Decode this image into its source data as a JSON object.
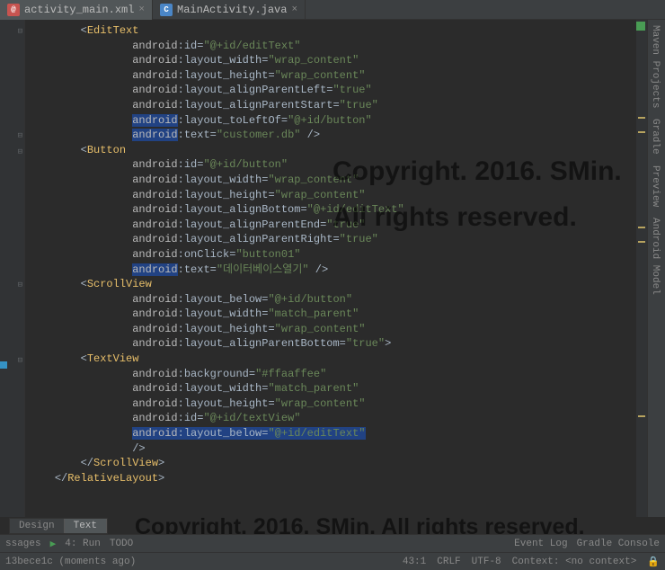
{
  "tabs": [
    {
      "icon": "xml",
      "iconText": "@",
      "label": "activity_main.xml",
      "close": "×"
    },
    {
      "icon": "java",
      "iconText": "C",
      "label": "MainActivity.java",
      "close": "×"
    }
  ],
  "editor": {
    "lines": [
      {
        "ind": 2,
        "parts": [
          {
            "c": "punc",
            "t": "<"
          },
          {
            "c": "tag",
            "t": "EditText"
          }
        ]
      },
      {
        "ind": 4,
        "parts": [
          {
            "c": "ns",
            "t": "android"
          },
          {
            "c": "attr",
            "t": ":id="
          },
          {
            "c": "str",
            "t": "\"@+id/editText\""
          }
        ]
      },
      {
        "ind": 4,
        "parts": [
          {
            "c": "ns",
            "t": "android"
          },
          {
            "c": "attr",
            "t": ":layout_width="
          },
          {
            "c": "str",
            "t": "\"wrap_content\""
          }
        ]
      },
      {
        "ind": 4,
        "parts": [
          {
            "c": "ns",
            "t": "android"
          },
          {
            "c": "attr",
            "t": ":layout_height="
          },
          {
            "c": "str",
            "t": "\"wrap_content\""
          }
        ]
      },
      {
        "ind": 4,
        "parts": [
          {
            "c": "ns",
            "t": "android"
          },
          {
            "c": "attr",
            "t": ":layout_alignParentLeft="
          },
          {
            "c": "str",
            "t": "\"true\""
          }
        ]
      },
      {
        "ind": 4,
        "parts": [
          {
            "c": "ns",
            "t": "android"
          },
          {
            "c": "attr",
            "t": ":layout_alignParentStart="
          },
          {
            "c": "str",
            "t": "\"true\""
          }
        ]
      },
      {
        "ind": 4,
        "parts": [
          {
            "c": "ns hl",
            "t": "android"
          },
          {
            "c": "attr",
            "t": ":layout_toLeftOf="
          },
          {
            "c": "str",
            "t": "\"@+id/button\""
          }
        ]
      },
      {
        "ind": 4,
        "parts": [
          {
            "c": "ns hl",
            "t": "android"
          },
          {
            "c": "attr",
            "t": ":text="
          },
          {
            "c": "str",
            "t": "\"customer.db\""
          },
          {
            "c": "punc",
            "t": " />"
          }
        ]
      },
      {
        "ind": 2,
        "parts": [
          {
            "c": "punc",
            "t": "<"
          },
          {
            "c": "tag",
            "t": "Button"
          }
        ]
      },
      {
        "ind": 4,
        "parts": [
          {
            "c": "ns",
            "t": "android"
          },
          {
            "c": "attr",
            "t": ":id="
          },
          {
            "c": "str",
            "t": "\"@+id/button\""
          }
        ]
      },
      {
        "ind": 4,
        "parts": [
          {
            "c": "ns",
            "t": "android"
          },
          {
            "c": "attr",
            "t": ":layout_width="
          },
          {
            "c": "str",
            "t": "\"wrap_content\""
          }
        ]
      },
      {
        "ind": 4,
        "parts": [
          {
            "c": "ns",
            "t": "android"
          },
          {
            "c": "attr",
            "t": ":layout_height="
          },
          {
            "c": "str",
            "t": "\"wrap_content\""
          }
        ]
      },
      {
        "ind": 4,
        "parts": [
          {
            "c": "ns",
            "t": "android"
          },
          {
            "c": "attr",
            "t": ":layout_alignBottom="
          },
          {
            "c": "str",
            "t": "\"@+id/editText\""
          }
        ]
      },
      {
        "ind": 4,
        "parts": [
          {
            "c": "ns",
            "t": "android"
          },
          {
            "c": "attr",
            "t": ":layout_alignParentEnd="
          },
          {
            "c": "str",
            "t": "\"true\""
          }
        ]
      },
      {
        "ind": 4,
        "parts": [
          {
            "c": "ns",
            "t": "android"
          },
          {
            "c": "attr",
            "t": ":layout_alignParentRight="
          },
          {
            "c": "str",
            "t": "\"true\""
          }
        ]
      },
      {
        "ind": 4,
        "parts": [
          {
            "c": "ns",
            "t": "android"
          },
          {
            "c": "attr",
            "t": ":onClick="
          },
          {
            "c": "str",
            "t": "\"button01\""
          }
        ]
      },
      {
        "ind": 4,
        "parts": [
          {
            "c": "ns hl",
            "t": "android"
          },
          {
            "c": "attr",
            "t": ":text="
          },
          {
            "c": "str",
            "t": "\"데이터베이스열기\""
          },
          {
            "c": "punc",
            "t": " />"
          }
        ]
      },
      {
        "ind": 2,
        "parts": [
          {
            "c": "punc",
            "t": "<"
          },
          {
            "c": "tag",
            "t": "ScrollView"
          }
        ]
      },
      {
        "ind": 4,
        "parts": [
          {
            "c": "ns",
            "t": "android"
          },
          {
            "c": "attr",
            "t": ":layout_below="
          },
          {
            "c": "str",
            "t": "\"@+id/button\""
          }
        ]
      },
      {
        "ind": 4,
        "parts": [
          {
            "c": "ns",
            "t": "android"
          },
          {
            "c": "attr",
            "t": ":layout_width="
          },
          {
            "c": "str",
            "t": "\"match_parent\""
          }
        ]
      },
      {
        "ind": 4,
        "parts": [
          {
            "c": "ns",
            "t": "android"
          },
          {
            "c": "attr",
            "t": ":layout_height="
          },
          {
            "c": "str",
            "t": "\"wrap_content\""
          }
        ]
      },
      {
        "ind": 4,
        "parts": [
          {
            "c": "ns",
            "t": "android"
          },
          {
            "c": "attr",
            "t": ":layout_alignParentBottom="
          },
          {
            "c": "str",
            "t": "\"true\""
          },
          {
            "c": "punc",
            "t": ">"
          }
        ]
      },
      {
        "ind": 2,
        "parts": [
          {
            "c": "punc",
            "t": "<"
          },
          {
            "c": "tag",
            "t": "TextView"
          }
        ]
      },
      {
        "ind": 4,
        "parts": [
          {
            "c": "ns",
            "t": "android"
          },
          {
            "c": "attr",
            "t": ":background="
          },
          {
            "c": "str",
            "t": "\"#ffaaffee\""
          }
        ]
      },
      {
        "ind": 4,
        "parts": [
          {
            "c": "ns",
            "t": "android"
          },
          {
            "c": "attr",
            "t": ":layout_width="
          },
          {
            "c": "str",
            "t": "\"match_parent\""
          }
        ]
      },
      {
        "ind": 4,
        "parts": [
          {
            "c": "ns",
            "t": "android"
          },
          {
            "c": "attr",
            "t": ":layout_height="
          },
          {
            "c": "str",
            "t": "\"wrap_content\""
          }
        ]
      },
      {
        "ind": 4,
        "parts": [
          {
            "c": "ns",
            "t": "android"
          },
          {
            "c": "attr",
            "t": ":id="
          },
          {
            "c": "str",
            "t": "\"@+id/textView\""
          }
        ]
      },
      {
        "ind": 4,
        "parts": [
          {
            "c": "ns hl",
            "t": "android"
          },
          {
            "c": "attr hl",
            "t": ":layout_below="
          },
          {
            "c": "str hl",
            "t": "\"@+id/editText\""
          }
        ]
      },
      {
        "ind": 4,
        "parts": [
          {
            "c": "punc",
            "t": "/>"
          }
        ]
      },
      {
        "ind": 2,
        "parts": [
          {
            "c": "punc",
            "t": "</"
          },
          {
            "c": "tag",
            "t": "ScrollView"
          },
          {
            "c": "punc",
            "t": ">"
          }
        ]
      },
      {
        "ind": 1,
        "parts": [
          {
            "c": "punc",
            "t": "</"
          },
          {
            "c": "tag",
            "t": "RelativeLayout"
          },
          {
            "c": "punc",
            "t": ">"
          }
        ]
      }
    ]
  },
  "rightTools": [
    {
      "label": "Maven Projects"
    },
    {
      "label": "Gradle"
    },
    {
      "label": "Preview"
    },
    {
      "label": "Android Model"
    }
  ],
  "bottomTabs": [
    {
      "label": "Design"
    },
    {
      "label": "Text"
    }
  ],
  "status1": {
    "ssages": "ssages",
    "run": "4: Run",
    "todo": "TODO",
    "eventlog": "Event Log",
    "gradle": "Gradle Console"
  },
  "status2": {
    "left": "13bece1c (moments ago)",
    "pos": "43:1",
    "crlf": "CRLF",
    "enc": "UTF-8",
    "ctx": "Context: <no context>"
  },
  "watermark": {
    "line1": "Copyright. 2016. SMin. All rights reserved.",
    "line2": "Copyright. 2016. SMin. All rights reserved."
  }
}
